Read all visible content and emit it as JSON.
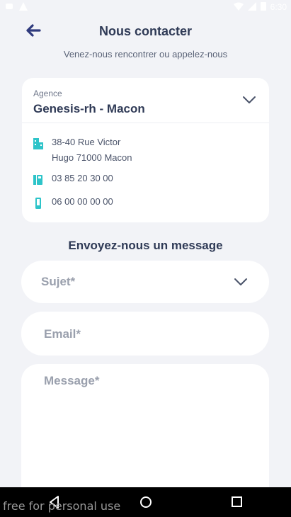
{
  "status_bar": {
    "time": "6:30"
  },
  "header": {
    "title": "Nous contacter",
    "subtitle": "Venez-nous rencontrer ou appelez-nous"
  },
  "agency": {
    "label": "Agence",
    "value": "Genesis-rh - Macon",
    "address_line1": "38-40 Rue Victor",
    "address_line2": "Hugo 71000 Macon",
    "phone": "03 85 20 30 00",
    "mobile": "06 00 00 00 00"
  },
  "form": {
    "section_title": "Envoyez-nous un message",
    "subject_placeholder": "Sujet*",
    "email_placeholder": "Email*",
    "message_placeholder": "Message*"
  },
  "watermark": "free for personal use",
  "colors": {
    "accent": "#2f3a7d",
    "icon_teal": "#2ec4c9",
    "background": "#f2f3f7"
  },
  "icons": {
    "back": "arrow-left-icon",
    "chevron": "chevron-down-icon",
    "address": "building-icon",
    "phone": "phone-icon",
    "mobile": "mobile-icon"
  }
}
